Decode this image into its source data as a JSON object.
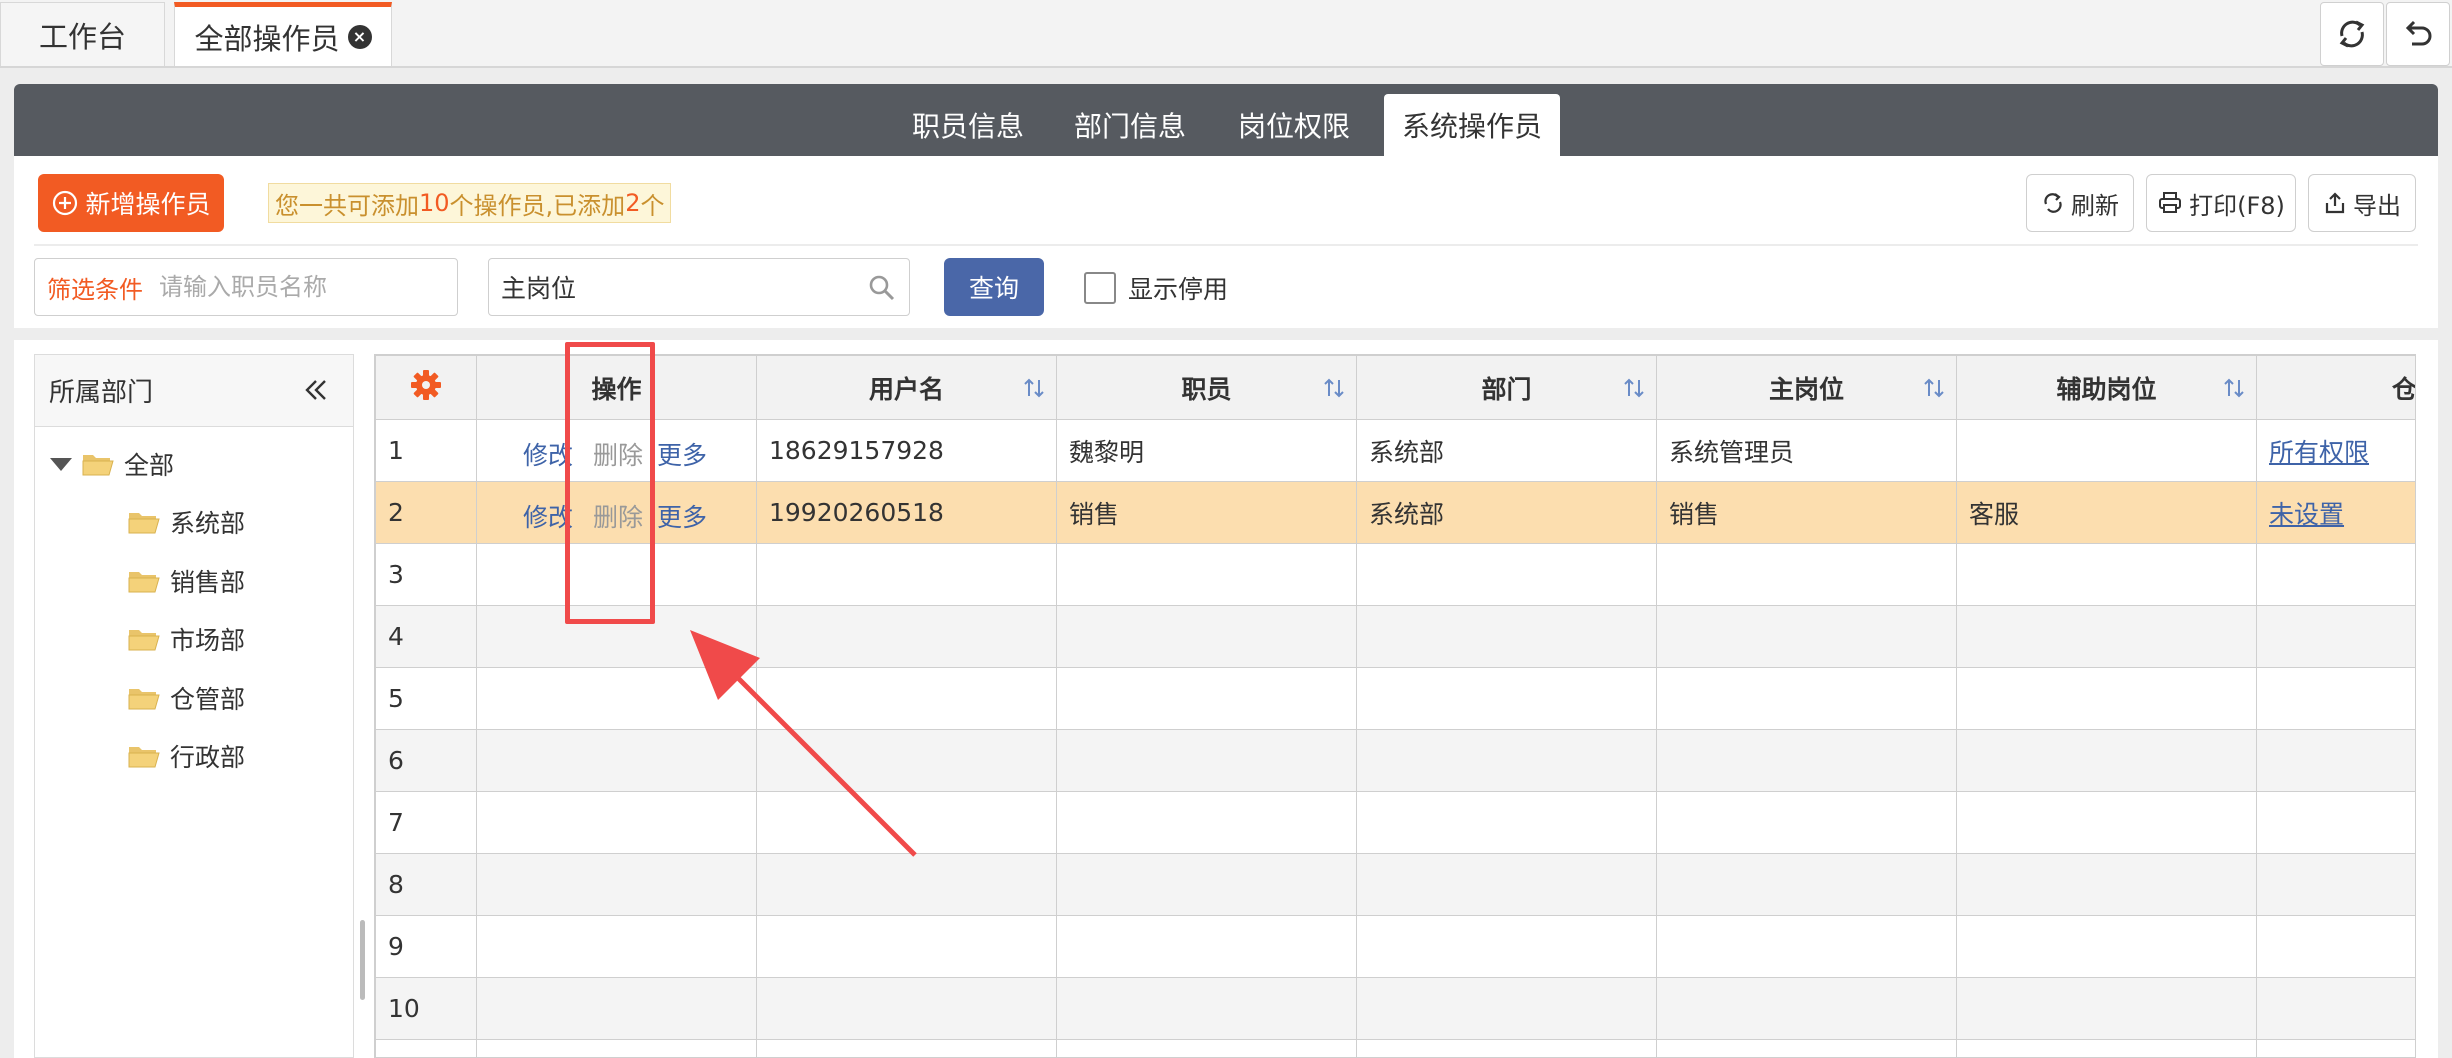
{
  "top_tabs": [
    {
      "label": "工作台"
    },
    {
      "label": "全部操作员"
    }
  ],
  "top_actions": {
    "refresh_icon": "sync-icon",
    "back_icon": "undo-icon"
  },
  "sub_tabs": [
    {
      "label": "职员信息"
    },
    {
      "label": "部门信息"
    },
    {
      "label": "岗位权限"
    },
    {
      "label": "系统操作员"
    }
  ],
  "toolbar": {
    "add_label": "新增操作员",
    "notice_prefix": "您一共可添加",
    "notice_max": "10",
    "notice_mid": "个操作员,已添加",
    "notice_added": "2",
    "notice_suffix": "个",
    "refresh_label": "刷新",
    "print_label": "打印(F8)",
    "export_label": "导出"
  },
  "filter": {
    "label": "筛选条件",
    "placeholder": "请输入职员名称",
    "position_value": "主岗位",
    "query_label": "查询",
    "show_disabled_label": "显示停用"
  },
  "dept_tree": {
    "title": "所属部门",
    "root": "全部",
    "children": [
      "系统部",
      "销售部",
      "市场部",
      "仓管部",
      "行政部"
    ]
  },
  "grid": {
    "columns": [
      "操作",
      "用户名",
      "职员",
      "部门",
      "主岗位",
      "辅助岗位",
      "仓"
    ],
    "op_labels": {
      "edit": "修改",
      "delete": "删除",
      "more": "更多"
    },
    "rows": [
      {
        "no": "1",
        "username": "18629157928",
        "employee": "魏黎明",
        "dept": "系统部",
        "main_pos": "系统管理员",
        "aux_pos": "",
        "warehouse": "所有权限"
      },
      {
        "no": "2",
        "username": "19920260518",
        "employee": "销售",
        "dept": "系统部",
        "main_pos": "销售",
        "aux_pos": "客服",
        "warehouse": "未设置"
      },
      {
        "no": "3"
      },
      {
        "no": "4"
      },
      {
        "no": "5"
      },
      {
        "no": "6"
      },
      {
        "no": "7"
      },
      {
        "no": "8"
      },
      {
        "no": "9"
      },
      {
        "no": "10"
      }
    ]
  },
  "colors": {
    "accent": "#f25b23",
    "primary": "#4a67a8",
    "highlight_row": "#fcdeaf",
    "annotation": "#f04a4a"
  }
}
